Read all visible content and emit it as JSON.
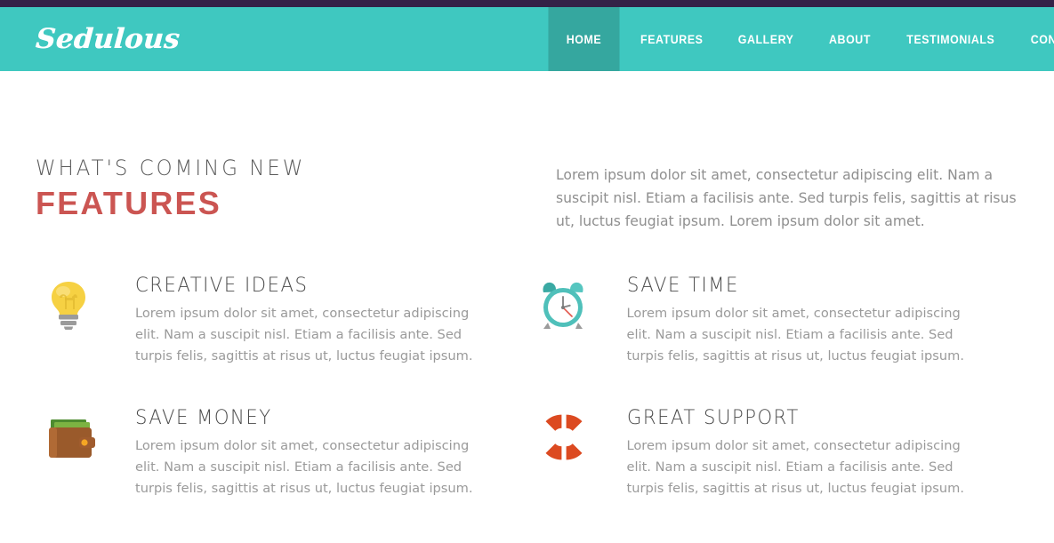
{
  "colors": {
    "topbar": "#342247",
    "header_teal": "#3fc8c0",
    "active_nav_teal": "#35a79f",
    "headline_red": "#cb5552",
    "body_text_grey": "#8f8f8f",
    "title_grey": "#4a4a4a"
  },
  "header": {
    "logo": "Sedulous",
    "nav": [
      {
        "label": "HOME",
        "active": true,
        "icon": "home-nav-item"
      },
      {
        "label": "FEATURES",
        "active": false,
        "icon": "features-nav-item"
      },
      {
        "label": "GALLERY",
        "active": false,
        "icon": "gallery-nav-item"
      },
      {
        "label": "ABOUT",
        "active": false,
        "icon": "about-nav-item"
      },
      {
        "label": "TESTIMONIALS",
        "active": false,
        "icon": "testimonials-nav-item"
      },
      {
        "label": "CONTACT",
        "active": false,
        "icon": "contact-nav-item"
      }
    ]
  },
  "intro": {
    "eyebrow": "What's coming new",
    "headline": "Features",
    "paragraph": "Lorem ipsum dolor sit amet, consectetur adipiscing elit. Nam a suscipit nisl. Etiam a facilisis ante. Sed turpis felis, sagittis at risus ut, luctus feugiat ipsum. Lorem ipsum dolor sit amet."
  },
  "features": [
    {
      "icon": "lightbulb-icon",
      "title": "Creative Ideas",
      "text": "Lorem ipsum dolor sit amet, consectetur adipiscing elit. Nam a suscipit nisl. Etiam a facilisis ante. Sed turpis felis, sagittis at risus ut, luctus feugiat ipsum."
    },
    {
      "icon": "alarm-clock-icon",
      "title": "Save Time",
      "text": "Lorem ipsum dolor sit amet, consectetur adipiscing elit. Nam a suscipit nisl. Etiam a facilisis ante. Sed turpis felis, sagittis at risus ut, luctus feugiat ipsum."
    },
    {
      "icon": "wallet-icon",
      "title": "Save Money",
      "text": "Lorem ipsum dolor sit amet, consectetur adipiscing elit. Nam a suscipit nisl. Etiam a facilisis ante. Sed turpis felis, sagittis at risus ut, luctus feugiat ipsum."
    },
    {
      "icon": "lifebuoy-support-icon",
      "title": "Great Support",
      "text": "Lorem ipsum dolor sit amet, consectetur adipiscing elit. Nam a suscipit nisl. Etiam a facilisis ante. Sed turpis felis, sagittis at risus ut, luctus feugiat ipsum."
    }
  ]
}
